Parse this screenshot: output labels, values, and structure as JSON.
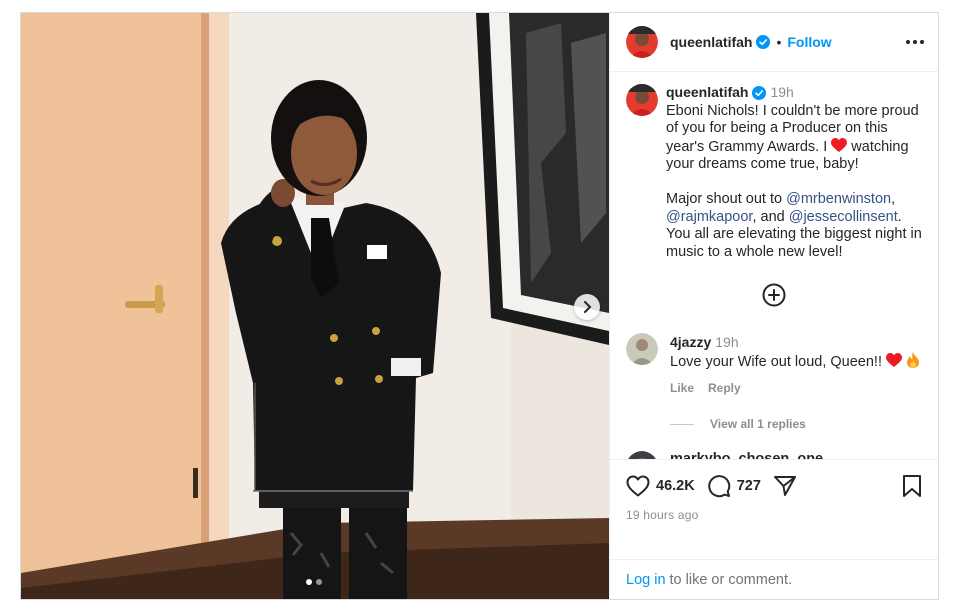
{
  "post": {
    "username": "queenlatifah",
    "follow_label": "Follow",
    "separator": "•",
    "more_icon": "more-horizontal-icon"
  },
  "caption": {
    "username": "queenlatifah",
    "time": "19h",
    "para1_a": "Eboni Nichols! I couldn't be more proud of you for being a Producer on this year's Grammy Awards. I ",
    "para1_b": " watching your dreams come true, baby!",
    "para2_a": "Major shout out to ",
    "mention1": "@mrbenwinston",
    "para2_b": ", ",
    "mention2": "@rajmkapoor",
    "para2_c": ", and ",
    "mention3": "@jessecollinsent",
    "para2_d": ". You all are elevating the biggest night in music to a whole new level!"
  },
  "comments": [
    {
      "username": "4jazzy",
      "time": "19h",
      "text": "Love your Wife out loud, Queen!! ",
      "like_label": "Like",
      "reply_label": "Reply",
      "view_replies": "View all 1 replies"
    },
    {
      "username": "markybo_chosen_one"
    }
  ],
  "stats": {
    "likes": "46.2K",
    "comments": "727",
    "posted_ago": "19 hours ago"
  },
  "login": {
    "link": "Log in",
    "rest": "to like or comment."
  },
  "colors": {
    "accent": "#0095f6",
    "heart": "#ed4956",
    "verified": "#0095f6"
  }
}
